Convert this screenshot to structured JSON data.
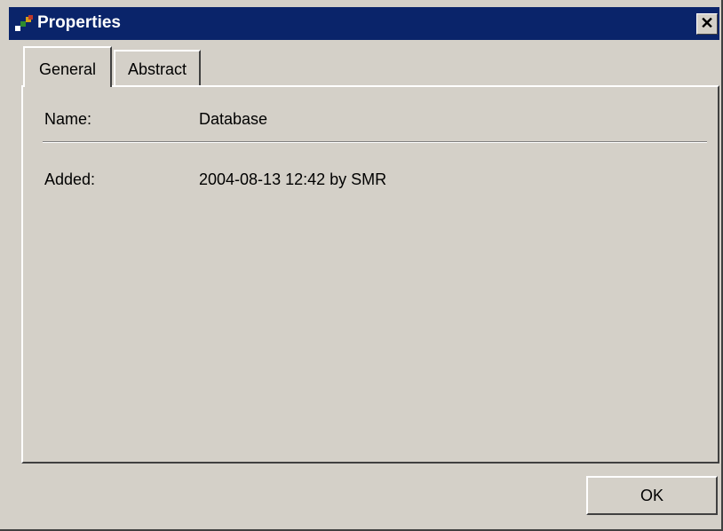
{
  "window": {
    "title": "Properties",
    "close_label": "✕",
    "icon": "properties-dots-icon"
  },
  "tabs": [
    {
      "label": "General",
      "selected": true
    },
    {
      "label": "Abstract",
      "selected": false
    }
  ],
  "general": {
    "name_label": "Name:",
    "name_value": "Database",
    "added_label": "Added:",
    "added_value": "2004-08-13 12:42 by SMR"
  },
  "buttons": {
    "ok_label": "OK"
  },
  "colors": {
    "titlebar": "#0a246a",
    "face": "#d4d0c8"
  }
}
